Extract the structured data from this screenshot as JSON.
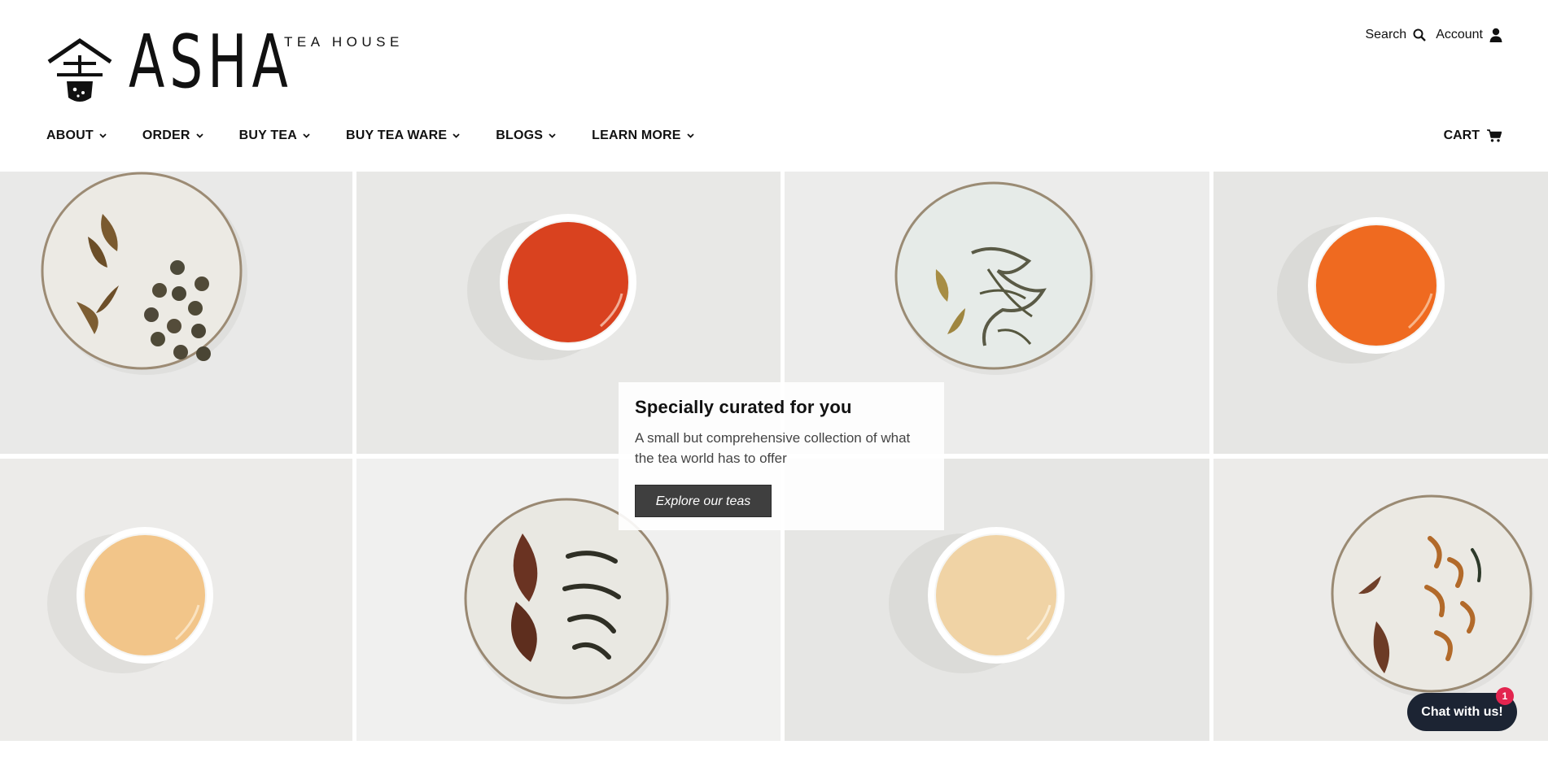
{
  "brand": {
    "name": "ASHA",
    "subtitle": "TEA HOUSE"
  },
  "utility": {
    "search_label": "Search",
    "account_label": "Account"
  },
  "nav": {
    "items": [
      {
        "label": "ABOUT"
      },
      {
        "label": "ORDER"
      },
      {
        "label": "BUY TEA"
      },
      {
        "label": "BUY TEA WARE"
      },
      {
        "label": "BLOGS"
      },
      {
        "label": "LEARN MORE"
      }
    ],
    "cart_label": "CART"
  },
  "hero": {
    "tiles": [
      {
        "kind": "leaf-plate-pearls"
      },
      {
        "kind": "tea-cup",
        "tea_color": "#d9421f"
      },
      {
        "kind": "leaf-plate-curled"
      },
      {
        "kind": "tea-cup",
        "tea_color": "#ef6a20"
      },
      {
        "kind": "tea-cup",
        "tea_color": "#f2c589"
      },
      {
        "kind": "leaf-plate-dark"
      },
      {
        "kind": "tea-cup",
        "tea_color": "#f0d3a5"
      },
      {
        "kind": "leaf-plate-twisted"
      }
    ],
    "promo": {
      "title": "Specially curated for you",
      "text": "A small but comprehensive collection of what the tea world has to offer",
      "button_label": "Explore our teas"
    }
  },
  "chat": {
    "label": "Chat with us!",
    "badge_count": "1"
  },
  "colors": {
    "accent_dark": "#3f3f3f",
    "chat_bg": "#1c2433",
    "badge": "#e3254f"
  },
  "icons": [
    "logo-mark-icon",
    "search-icon",
    "account-icon",
    "chevron-down-icon",
    "cart-icon"
  ]
}
